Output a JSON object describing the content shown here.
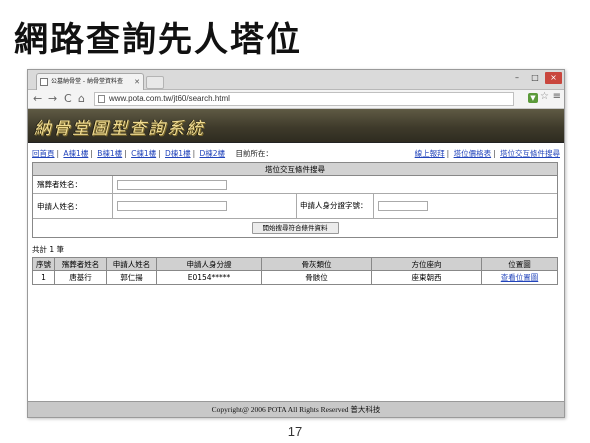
{
  "slide": {
    "title": "網路查詢先人塔位",
    "page_number": "17"
  },
  "browser": {
    "tab_title": "公墓納骨堂 - 納骨堂資料查",
    "url": "www.pota.com.tw/jt60/search.html",
    "controls": {
      "minimize": "–",
      "maximize": "□",
      "close": "×"
    }
  },
  "site": {
    "banner_title": "納骨堂圖型查詢系統",
    "nav_links": [
      "回首頁",
      "A棟1樓",
      "B棟1樓",
      "C棟1樓",
      "D棟1樓",
      "D棟2樓"
    ],
    "location_label": "目前所在：",
    "right_links": [
      "線上報拜",
      "塔位價格表",
      "塔位交互條件搜尋"
    ]
  },
  "search": {
    "header": "塔位交互條件搜尋",
    "deceased_name_label": "殯葬者姓名：",
    "deceased_name_value": "",
    "applicant_name_label": "申請人姓名：",
    "applicant_name_value": "",
    "applicant_id_label": "申請人身分證字號：",
    "applicant_id_value": "",
    "submit_label": "開始搜尋符合條件資料"
  },
  "results": {
    "total_label": "共計 1 筆",
    "columns": [
      "序號",
      "殯葬者姓名",
      "申請人姓名",
      "申請人身分證",
      "骨灰類位",
      "方位座向",
      "位置圖"
    ],
    "rows": [
      {
        "no": "1",
        "deceased": "唐基行",
        "applicant": "郭仁揚",
        "id": "E0154*****",
        "type": "骨骸位",
        "direction": "座東朝西",
        "map_link": "查看位置圖"
      }
    ]
  },
  "footer": {
    "copyright": "Copyright@  2006  POTA  All  Rights  Reserved    普大科技"
  }
}
